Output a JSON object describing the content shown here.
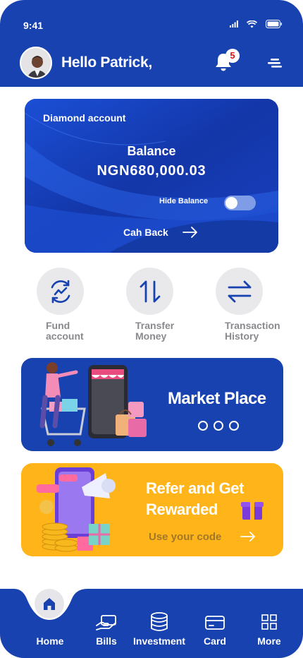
{
  "status_bar": {
    "time": "9:41"
  },
  "header": {
    "greeting": "Hello Patrick,",
    "notification_count": "5"
  },
  "card": {
    "account_type": "Diamond account",
    "balance_label": "Balance",
    "balance_amount": "NGN680,000.03",
    "hide_balance_label": "Hide Balance",
    "hide_balance_on": false,
    "cashback_label": "Cah Back"
  },
  "actions": [
    {
      "line1": "Fund",
      "line2": "account",
      "icon": "refresh-chart-icon"
    },
    {
      "line1": "Transfer",
      "line2": "Money",
      "icon": "up-down-arrows-icon"
    },
    {
      "line1": "Transaction",
      "line2": "History",
      "icon": "swap-arrows-icon"
    }
  ],
  "market": {
    "title": "Market Place"
  },
  "refer": {
    "title_line1": "Refer and Get",
    "title_line2": "Rewarded",
    "code_label": "Use your code"
  },
  "nav": [
    {
      "label": "Home",
      "icon": "home-icon",
      "active": true
    },
    {
      "label": "Bills",
      "icon": "bill-hand-icon"
    },
    {
      "label": "Investment",
      "icon": "coins-stack-icon"
    },
    {
      "label": "Card",
      "icon": "credit-card-icon"
    },
    {
      "label": "More",
      "icon": "grid-icon"
    }
  ],
  "colors": {
    "primary": "#1742b0",
    "accent_yellow": "#ffb41a",
    "badge_red": "#d01818",
    "action_grey": "#e9e9ec"
  }
}
